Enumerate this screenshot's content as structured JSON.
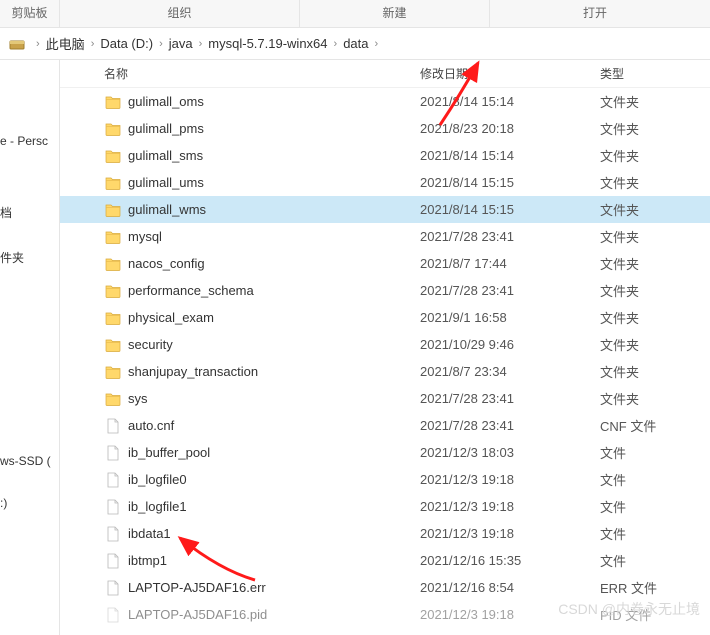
{
  "ribbon": {
    "clipboard": "剪贴板",
    "organize": "组织",
    "new": "新建",
    "open": "打开"
  },
  "breadcrumb": {
    "root": "此电脑",
    "drive": "Data (D:)",
    "p1": "java",
    "p2": "mysql-5.7.19-winx64",
    "p3": "data"
  },
  "sidebar": {
    "item1": "e - Persc",
    "item2": "",
    "item3": "档",
    "item4": "件夹",
    "item5": "ws-SSD (",
    "item6": ":)"
  },
  "columns": {
    "name": "名称",
    "date": "修改日期",
    "type": "类型"
  },
  "files": [
    {
      "icon": "folder",
      "name": "gulimall_oms",
      "date": "2021/8/14 15:14",
      "type": "文件夹"
    },
    {
      "icon": "folder",
      "name": "gulimall_pms",
      "date": "2021/8/23 20:18",
      "type": "文件夹"
    },
    {
      "icon": "folder",
      "name": "gulimall_sms",
      "date": "2021/8/14 15:14",
      "type": "文件夹"
    },
    {
      "icon": "folder",
      "name": "gulimall_ums",
      "date": "2021/8/14 15:15",
      "type": "文件夹"
    },
    {
      "icon": "folder",
      "name": "gulimall_wms",
      "date": "2021/8/14 15:15",
      "type": "文件夹",
      "selected": true
    },
    {
      "icon": "folder",
      "name": "mysql",
      "date": "2021/7/28 23:41",
      "type": "文件夹"
    },
    {
      "icon": "folder",
      "name": "nacos_config",
      "date": "2021/8/7 17:44",
      "type": "文件夹"
    },
    {
      "icon": "folder",
      "name": "performance_schema",
      "date": "2021/7/28 23:41",
      "type": "文件夹"
    },
    {
      "icon": "folder",
      "name": "physical_exam",
      "date": "2021/9/1 16:58",
      "type": "文件夹"
    },
    {
      "icon": "folder",
      "name": "security",
      "date": "2021/10/29 9:46",
      "type": "文件夹"
    },
    {
      "icon": "folder",
      "name": "shanjupay_transaction",
      "date": "2021/8/7 23:34",
      "type": "文件夹"
    },
    {
      "icon": "folder",
      "name": "sys",
      "date": "2021/7/28 23:41",
      "type": "文件夹"
    },
    {
      "icon": "file",
      "name": "auto.cnf",
      "date": "2021/7/28 23:41",
      "type": "CNF 文件"
    },
    {
      "icon": "file",
      "name": "ib_buffer_pool",
      "date": "2021/12/3 18:03",
      "type": "文件"
    },
    {
      "icon": "file",
      "name": "ib_logfile0",
      "date": "2021/12/3 19:18",
      "type": "文件"
    },
    {
      "icon": "file",
      "name": "ib_logfile1",
      "date": "2021/12/3 19:18",
      "type": "文件"
    },
    {
      "icon": "file",
      "name": "ibdata1",
      "date": "2021/12/3 19:18",
      "type": "文件"
    },
    {
      "icon": "file",
      "name": "ibtmp1",
      "date": "2021/12/16 15:35",
      "type": "文件"
    },
    {
      "icon": "file",
      "name": "LAPTOP-AJ5DAF16.err",
      "date": "2021/12/16 8:54",
      "type": "ERR 文件"
    },
    {
      "icon": "file",
      "name": "LAPTOP-AJ5DAF16.pid",
      "date": "2021/12/3 19:18",
      "type": "PID 文件",
      "cut": true
    }
  ],
  "watermark": "CSDN @内卷永无止境"
}
